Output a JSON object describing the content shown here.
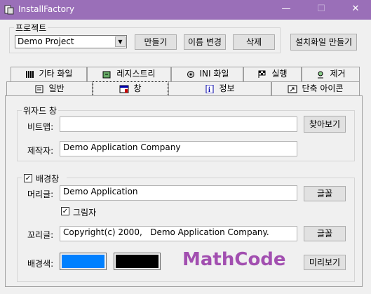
{
  "window": {
    "title": "InstallFactory"
  },
  "window_controls": {
    "minimize": "—",
    "maximize": "☐",
    "close": "✕"
  },
  "project_group": {
    "label": "프로젝트",
    "selected_project": "Demo Project",
    "buttons": {
      "create": "만들기",
      "rename": "이름 변경",
      "delete": "삭제"
    }
  },
  "make_setup_button": "설치화일 만들기",
  "tabs_row1": [
    {
      "label": "기타 화일",
      "icon": "files-icon"
    },
    {
      "label": "레지스트리",
      "icon": "registry-icon"
    },
    {
      "label": "INI 화일",
      "icon": "gear-icon"
    },
    {
      "label": "실행",
      "icon": "flag-icon"
    },
    {
      "label": "제거",
      "icon": "uninstall-icon"
    }
  ],
  "tabs_row2": [
    {
      "label": "일반",
      "icon": "general-icon"
    },
    {
      "label": "창",
      "icon": "window-icon",
      "active": true
    },
    {
      "label": "정보",
      "icon": "info-icon"
    },
    {
      "label": "단축 아이콘",
      "icon": "shortcut-icon"
    }
  ],
  "wizard_group": {
    "label": "위자드 창",
    "bitmap_label": "비트맵:",
    "bitmap_value": "",
    "browse_button": "찾아보기",
    "maker_label": "제작자:",
    "maker_value": "Demo Application Company"
  },
  "background_group": {
    "label": "배경창",
    "checked": true,
    "header_label": "머리글:",
    "header_value": "Demo Application",
    "font_button_1": "글꼴",
    "shadow_label": "그림자",
    "shadow_checked": true,
    "footer_label": "꼬리글:",
    "footer_value": "Copyright(c) 2000,   Demo Application Company.",
    "font_button_2": "글꼴",
    "bgcolor_label": "배경색:",
    "colors": {
      "color1": "#0080ff",
      "color2": "#000000"
    },
    "preview_button": "미리보기"
  },
  "watermark": "MathCode"
}
